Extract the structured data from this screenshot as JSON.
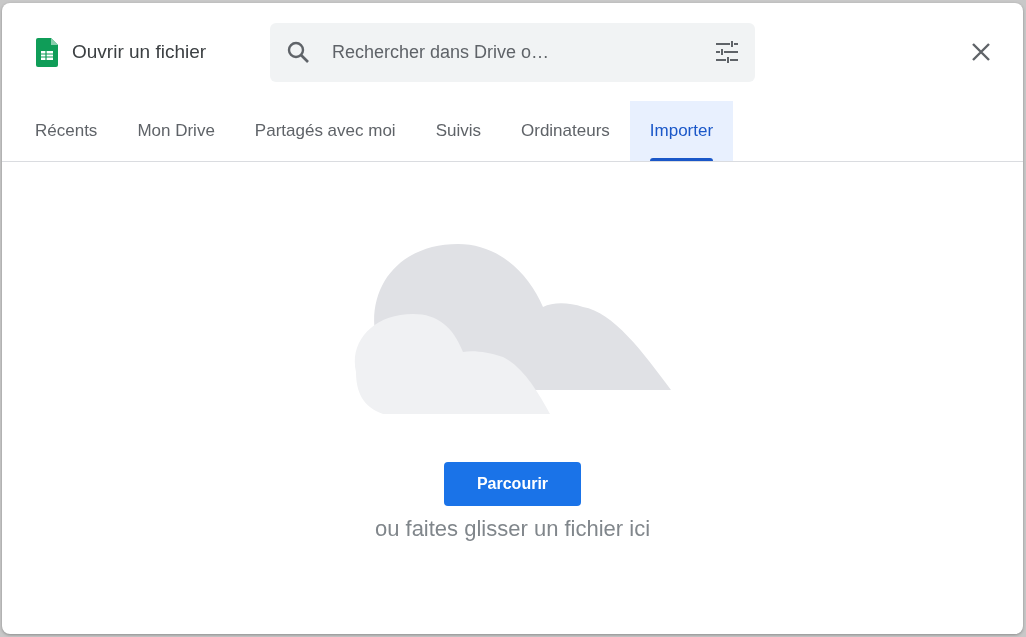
{
  "dialog": {
    "title": "Ouvrir un fichier"
  },
  "search": {
    "placeholder": "Rechercher dans Drive o…"
  },
  "tabs": [
    {
      "label": "Récents",
      "selected": false
    },
    {
      "label": "Mon Drive",
      "selected": false
    },
    {
      "label": "Partagés avec moi",
      "selected": false
    },
    {
      "label": "Suivis",
      "selected": false
    },
    {
      "label": "Ordinateurs",
      "selected": false
    },
    {
      "label": "Importer",
      "selected": true
    }
  ],
  "upload": {
    "button": "Parcourir",
    "hint": "ou faites glisser un fichier ici"
  }
}
